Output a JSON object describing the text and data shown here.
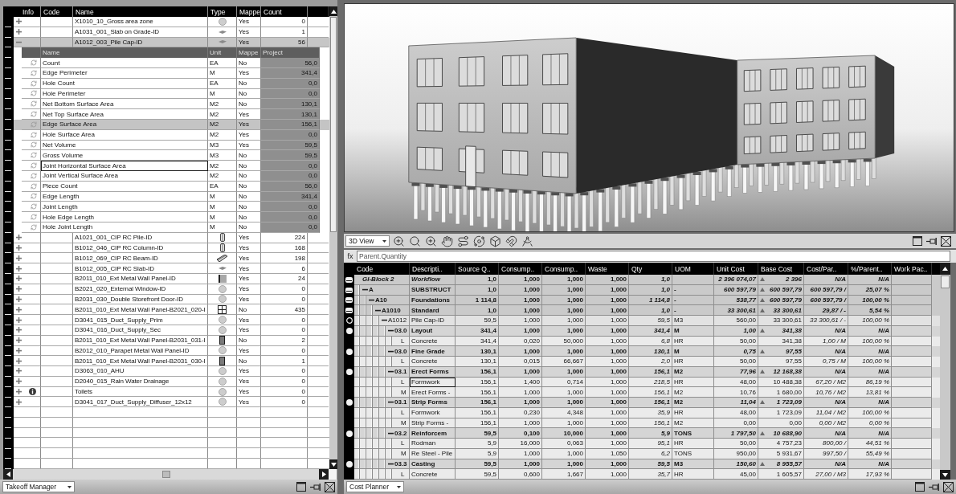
{
  "takeoff_manager": {
    "columns": [
      "Info",
      "Code",
      "Name",
      "Type",
      "Mappe",
      "Count"
    ],
    "rows": [
      {
        "name": "X1010_10_Gross area zone",
        "kind": "circle",
        "mapped": "Yes",
        "count": "0",
        "expanded": false,
        "selected": false,
        "info": false
      },
      {
        "name": "A1031_001_Slab on Grade-ID",
        "kind": "slab",
        "mapped": "Yes",
        "count": "1",
        "expanded": false,
        "selected": false,
        "info": false
      },
      {
        "name": "A1012_003_Pile Cap-ID",
        "kind": "slab",
        "mapped": "Yes",
        "count": "56",
        "expanded": true,
        "selected": true,
        "info": false,
        "quantities": {
          "columns": [
            "Name",
            "Unit",
            "Mappe",
            "Project"
          ],
          "rows": [
            {
              "name": "Count",
              "unit": "EA",
              "mapped": "No",
              "project": "56,0",
              "selected": false,
              "focused": false
            },
            {
              "name": "Edge Perimeter",
              "unit": "M",
              "mapped": "Yes",
              "project": "341,4",
              "selected": false,
              "focused": false
            },
            {
              "name": "Hole Count",
              "unit": "EA",
              "mapped": "No",
              "project": "0,0",
              "selected": false,
              "focused": false
            },
            {
              "name": "Hole Perimeter",
              "unit": "M",
              "mapped": "No",
              "project": "0,0",
              "selected": false,
              "focused": false
            },
            {
              "name": "Net Bottom Surface Area",
              "unit": "M2",
              "mapped": "No",
              "project": "130,1",
              "selected": false,
              "focused": false
            },
            {
              "name": "Net Top Surface Area",
              "unit": "M2",
              "mapped": "Yes",
              "project": "130,1",
              "selected": false,
              "focused": false
            },
            {
              "name": "Edge Surface Area",
              "unit": "M2",
              "mapped": "Yes",
              "project": "156,1",
              "selected": true,
              "focused": false
            },
            {
              "name": "Hole Surface Area",
              "unit": "M2",
              "mapped": "Yes",
              "project": "0,0",
              "selected": false,
              "focused": false
            },
            {
              "name": "Net Volume",
              "unit": "M3",
              "mapped": "Yes",
              "project": "59,5",
              "selected": false,
              "focused": false
            },
            {
              "name": "Gross Volume",
              "unit": "M3",
              "mapped": "No",
              "project": "59,5",
              "selected": false,
              "focused": false
            },
            {
              "name": "Joint Horizontal Surface Area",
              "unit": "M2",
              "mapped": "No",
              "project": "0,0",
              "selected": false,
              "focused": true
            },
            {
              "name": "Joint Vertical Surface Area",
              "unit": "M2",
              "mapped": "No",
              "project": "0,0",
              "selected": false,
              "focused": false
            },
            {
              "name": "Piece Count",
              "unit": "EA",
              "mapped": "No",
              "project": "56,0",
              "selected": false,
              "focused": false
            },
            {
              "name": "Edge Length",
              "unit": "M",
              "mapped": "No",
              "project": "341,4",
              "selected": false,
              "focused": false
            },
            {
              "name": "Joint Length",
              "unit": "M",
              "mapped": "No",
              "project": "0,0",
              "selected": false,
              "focused": false
            },
            {
              "name": "Hole Edge Length",
              "unit": "M",
              "mapped": "No",
              "project": "0,0",
              "selected": false,
              "focused": false
            },
            {
              "name": "Hole Joint Length",
              "unit": "M",
              "mapped": "No",
              "project": "0,0",
              "selected": false,
              "focused": false
            }
          ]
        }
      },
      {
        "name": "A1021_001_CIP RC Pile-ID",
        "kind": "column",
        "mapped": "Yes",
        "count": "224",
        "expanded": false,
        "selected": false,
        "info": false
      },
      {
        "name": "B1012_046_CIP RC Column-ID",
        "kind": "column",
        "mapped": "Yes",
        "count": "168",
        "expanded": false,
        "selected": false,
        "info": false
      },
      {
        "name": "B1012_069_CIP RC Beam-ID",
        "kind": "beam",
        "mapped": "Yes",
        "count": "198",
        "expanded": false,
        "selected": false,
        "info": false
      },
      {
        "name": "B1012_005_CIP RC Slab-ID",
        "kind": "slab",
        "mapped": "Yes",
        "count": "6",
        "expanded": false,
        "selected": false,
        "info": false
      },
      {
        "name": "B2011_010_Ext Metal Wall Panel-ID",
        "kind": "panel",
        "mapped": "Yes",
        "count": "24",
        "expanded": false,
        "selected": false,
        "info": false
      },
      {
        "name": "B2021_020_External Window-ID",
        "kind": "circle",
        "mapped": "Yes",
        "count": "0",
        "expanded": false,
        "selected": false,
        "info": false
      },
      {
        "name": "B2031_030_Double Storefront Door-ID",
        "kind": "circle",
        "mapped": "Yes",
        "count": "0",
        "expanded": false,
        "selected": false,
        "info": false
      },
      {
        "name": "B2011_010_Ext Metal Wall Panel-B2021_020-I",
        "kind": "grid",
        "mapped": "No",
        "count": "435",
        "expanded": false,
        "selected": false,
        "info": false
      },
      {
        "name": "D3041_015_Duct_Supply_Prim",
        "kind": "circle",
        "mapped": "Yes",
        "count": "0",
        "expanded": false,
        "selected": false,
        "info": false
      },
      {
        "name": "D3041_016_Duct_Supply_Sec",
        "kind": "circle",
        "mapped": "Yes",
        "count": "0",
        "expanded": false,
        "selected": false,
        "info": false
      },
      {
        "name": "B2011_010_Ext Metal Wall Panel-B2031_031-I",
        "kind": "door",
        "mapped": "No",
        "count": "2",
        "expanded": false,
        "selected": false,
        "info": false
      },
      {
        "name": "B2012_010_Parapet Metal Wall Panel-ID",
        "kind": "circle",
        "mapped": "Yes",
        "count": "0",
        "expanded": false,
        "selected": false,
        "info": false
      },
      {
        "name": "B2011_010_Ext Metal Wall Panel-B2031_030-I",
        "kind": "door",
        "mapped": "No",
        "count": "1",
        "expanded": false,
        "selected": false,
        "info": false
      },
      {
        "name": "D3063_010_AHU",
        "kind": "circle",
        "mapped": "Yes",
        "count": "0",
        "expanded": false,
        "selected": false,
        "info": false
      },
      {
        "name": "D2040_015_Rain Water Drainage",
        "kind": "circle",
        "mapped": "Yes",
        "count": "0",
        "expanded": false,
        "selected": false,
        "info": false
      },
      {
        "name": "Toilets",
        "kind": "circle",
        "mapped": "Yes",
        "count": "0",
        "expanded": false,
        "selected": false,
        "info": true
      },
      {
        "name": "D3041_017_Duct_Supply_Diffuser_12x12",
        "kind": "circle",
        "mapped": "Yes",
        "count": "0",
        "expanded": false,
        "selected": false,
        "info": false
      }
    ],
    "footer": {
      "view": "Takeoff Manager"
    }
  },
  "viewer": {
    "view": "3D View"
  },
  "formula_bar": {
    "label": "fx",
    "value": "Parent.Quantity"
  },
  "cost_planner": {
    "columns": [
      "Code",
      "Descripti..",
      "Source Q..",
      "Consump..",
      "Consump..",
      "Waste",
      "Qty",
      "UOM",
      "Unit Cost",
      "Base Cost",
      "Cost/Par..",
      "%/Parent..",
      "Work Pac.."
    ],
    "rows": [
      {
        "kind": "root",
        "code": "GI-Block 2",
        "description": "Workflow",
        "source_qty": "1,0",
        "consumption_a": "1,000",
        "consumption_b": "1,000",
        "waste": "1,000",
        "qty": "1,0",
        "unit_cost": "2 396 074,07",
        "base_cost": "2 396",
        "summed": true,
        "cost_per_parent": "N/A",
        "percent_of_parent": "N/A",
        "focused": false,
        "children": [
          {
            "kind": "group",
            "code": "A",
            "description": "SUBSTRUCT",
            "source_qty": "1,0",
            "consumption_a": "1,000",
            "consumption_b": "1,000",
            "waste": "1,000",
            "qty": "1,0",
            "uom": "-",
            "unit_cost": "600 597,79",
            "base_cost": "600 597,79",
            "summed": true,
            "cost_per_parent": "600 597,79 /",
            "percent_of_parent": "25,07 %",
            "focused": false,
            "expanded": true,
            "children": [
              {
                "kind": "group",
                "code": "A10",
                "description": "Foundations",
                "source_qty": "1 114,8",
                "consumption_a": "1,000",
                "consumption_b": "1,000",
                "waste": "1,000",
                "qty": "1 114,8",
                "uom": "-",
                "unit_cost": "538,77",
                "base_cost": "600 597,79",
                "summed": true,
                "cost_per_parent": "600 597,79 /",
                "percent_of_parent": "100,00 %",
                "focused": false,
                "expanded": true,
                "children": [
                  {
                    "kind": "group",
                    "code": "A1010",
                    "description": "Standard",
                    "source_qty": "1,0",
                    "consumption_a": "1,000",
                    "consumption_b": "1,000",
                    "waste": "1,000",
                    "qty": "1,0",
                    "uom": "-",
                    "unit_cost": "33 300,61",
                    "base_cost": "33 300,61",
                    "summed": true,
                    "cost_per_parent": "29,87 / -",
                    "percent_of_parent": "5,54 %",
                    "focused": false,
                    "expanded": true,
                    "children": [
                      {
                        "kind": "assembly",
                        "code": "A1012",
                        "description": "Pile Cap-ID",
                        "source_qty": "59,5",
                        "consumption_a": "1,000",
                        "consumption_b": "1,000",
                        "waste": "1,000",
                        "qty": "59,5",
                        "uom": "M3",
                        "unit_cost": "560,00",
                        "base_cost": "33 300,61",
                        "summed": false,
                        "cost_per_parent": "33 300,61 / -",
                        "percent_of_parent": "100,00 %",
                        "focused": false,
                        "expanded": true,
                        "children": [
                          {
                            "kind": "task",
                            "code": "03.0",
                            "description": "Layout",
                            "source_qty": "341,4",
                            "consumption_a": "1,000",
                            "consumption_b": "1,000",
                            "waste": "1,000",
                            "qty": "341,4",
                            "uom": "M",
                            "unit_cost": "1,00",
                            "base_cost": "341,38",
                            "summed": true,
                            "cost_per_parent": "N/A",
                            "percent_of_parent": "N/A",
                            "focused": false,
                            "expanded": true,
                            "children": [
                              {
                                "kind": "resource",
                                "code": "L",
                                "description": "Concrete",
                                "source_qty": "341,4",
                                "consumption_a": "0,020",
                                "consumption_b": "50,000",
                                "waste": "1,000",
                                "qty": "6,8",
                                "uom": "HR",
                                "unit_cost": "50,00",
                                "base_cost": "341,38",
                                "summed": false,
                                "cost_per_parent": "1,00 / M",
                                "percent_of_parent": "100,00 %",
                                "focused": false
                              }
                            ]
                          },
                          {
                            "kind": "task",
                            "code": "03.0",
                            "description": "Fine Grade",
                            "source_qty": "130,1",
                            "consumption_a": "1,000",
                            "consumption_b": "1,000",
                            "waste": "1,000",
                            "qty": "130,1",
                            "uom": "M",
                            "unit_cost": "0,75",
                            "base_cost": "97,55",
                            "summed": true,
                            "cost_per_parent": "N/A",
                            "percent_of_parent": "N/A",
                            "focused": false,
                            "expanded": true,
                            "children": [
                              {
                                "kind": "resource",
                                "code": "L",
                                "description": "Concrete",
                                "source_qty": "130,1",
                                "consumption_a": "0,015",
                                "consumption_b": "66,667",
                                "waste": "1,000",
                                "qty": "2,0",
                                "uom": "HR",
                                "unit_cost": "50,00",
                                "base_cost": "97,55",
                                "summed": false,
                                "cost_per_parent": "0,75 / M",
                                "percent_of_parent": "100,00 %",
                                "focused": false
                              }
                            ]
                          },
                          {
                            "kind": "task",
                            "code": "03.1",
                            "description": "Erect Forms",
                            "source_qty": "156,1",
                            "consumption_a": "1,000",
                            "consumption_b": "1,000",
                            "waste": "1,000",
                            "qty": "156,1",
                            "uom": "M2",
                            "unit_cost": "77,96",
                            "base_cost": "12 168,38",
                            "summed": true,
                            "cost_per_parent": "N/A",
                            "percent_of_parent": "N/A",
                            "focused": false,
                            "expanded": true,
                            "children": [
                              {
                                "kind": "resource",
                                "code": "L",
                                "description": "Formwork",
                                "source_qty": "156,1",
                                "consumption_a": "1,400",
                                "consumption_b": "0,714",
                                "waste": "1,000",
                                "qty": "218,5",
                                "uom": "HR",
                                "unit_cost": "48,00",
                                "base_cost": "10 488,38",
                                "summed": false,
                                "cost_per_parent": "67,20 / M2",
                                "percent_of_parent": "86,19 %",
                                "focused": true
                              },
                              {
                                "kind": "resource",
                                "code": "M",
                                "description": "Erect Forms -",
                                "source_qty": "156,1",
                                "consumption_a": "1,000",
                                "consumption_b": "1,000",
                                "waste": "1,000",
                                "qty": "156,1",
                                "uom": "M2",
                                "unit_cost": "10,76",
                                "base_cost": "1 680,00",
                                "summed": false,
                                "cost_per_parent": "10,76 / M2",
                                "percent_of_parent": "13,81 %",
                                "focused": false
                              }
                            ]
                          },
                          {
                            "kind": "task",
                            "code": "03.1",
                            "description": "Strip Forms",
                            "source_qty": "156,1",
                            "consumption_a": "1,000",
                            "consumption_b": "1,000",
                            "waste": "1,000",
                            "qty": "156,1",
                            "uom": "M2",
                            "unit_cost": "11,04",
                            "base_cost": "1 723,09",
                            "summed": true,
                            "cost_per_parent": "N/A",
                            "percent_of_parent": "N/A",
                            "focused": false,
                            "expanded": true,
                            "children": [
                              {
                                "kind": "resource",
                                "code": "L",
                                "description": "Formwork",
                                "source_qty": "156,1",
                                "consumption_a": "0,230",
                                "consumption_b": "4,348",
                                "waste": "1,000",
                                "qty": "35,9",
                                "uom": "HR",
                                "unit_cost": "48,00",
                                "base_cost": "1 723,09",
                                "summed": false,
                                "cost_per_parent": "11,04 / M2",
                                "percent_of_parent": "100,00 %",
                                "focused": false
                              },
                              {
                                "kind": "resource",
                                "code": "M",
                                "description": "Strip Forms -",
                                "source_qty": "156,1",
                                "consumption_a": "1,000",
                                "consumption_b": "1,000",
                                "waste": "1,000",
                                "qty": "156,1",
                                "uom": "M2",
                                "unit_cost": "0,00",
                                "base_cost": "0,00",
                                "summed": false,
                                "cost_per_parent": "0,00 / M2",
                                "percent_of_parent": "0,00 %",
                                "focused": false
                              }
                            ]
                          },
                          {
                            "kind": "task",
                            "code": "03.2",
                            "description": "Reinforcem",
                            "source_qty": "59,5",
                            "consumption_a": "0,100",
                            "consumption_b": "10,000",
                            "waste": "1,000",
                            "qty": "5,9",
                            "uom": "TONS",
                            "unit_cost": "1 797,50",
                            "base_cost": "10 688,90",
                            "summed": true,
                            "cost_per_parent": "N/A",
                            "percent_of_parent": "N/A",
                            "focused": false,
                            "expanded": true,
                            "children": [
                              {
                                "kind": "resource",
                                "code": "L",
                                "description": "Rodman",
                                "source_qty": "5,9",
                                "consumption_a": "16,000",
                                "consumption_b": "0,063",
                                "waste": "1,000",
                                "qty": "95,1",
                                "uom": "HR",
                                "unit_cost": "50,00",
                                "base_cost": "4 757,23",
                                "summed": false,
                                "cost_per_parent": "800,00 /",
                                "percent_of_parent": "44,51 %",
                                "focused": false
                              },
                              {
                                "kind": "resource",
                                "code": "M",
                                "description": "Re Steel - Pile",
                                "source_qty": "5,9",
                                "consumption_a": "1,000",
                                "consumption_b": "1,000",
                                "waste": "1,050",
                                "qty": "6,2",
                                "uom": "TONS",
                                "unit_cost": "950,00",
                                "base_cost": "5 931,67",
                                "summed": false,
                                "cost_per_parent": "997,50 /",
                                "percent_of_parent": "55,49 %",
                                "focused": false
                              }
                            ]
                          },
                          {
                            "kind": "task",
                            "code": "03.3",
                            "description": "Casting",
                            "source_qty": "59,5",
                            "consumption_a": "1,000",
                            "consumption_b": "1,000",
                            "waste": "1,000",
                            "qty": "59,5",
                            "uom": "M3",
                            "unit_cost": "150,60",
                            "base_cost": "8 955,57",
                            "summed": true,
                            "cost_per_parent": "N/A",
                            "percent_of_parent": "N/A",
                            "focused": false,
                            "expanded": true,
                            "children": [
                              {
                                "kind": "resource",
                                "code": "L",
                                "description": "Concrete",
                                "source_qty": "59,5",
                                "consumption_a": "0,600",
                                "consumption_b": "1,667",
                                "waste": "1,000",
                                "qty": "35,7",
                                "uom": "HR",
                                "unit_cost": "45,00",
                                "base_cost": "1 605,57",
                                "summed": false,
                                "cost_per_parent": "27,00 / M3",
                                "percent_of_parent": "17,93 %",
                                "focused": false
                              }
                            ]
                          }
                        ]
                      }
                    ]
                  }
                ]
              }
            ]
          }
        ]
      }
    ],
    "footer": {
      "view": "Cost Planner"
    }
  }
}
